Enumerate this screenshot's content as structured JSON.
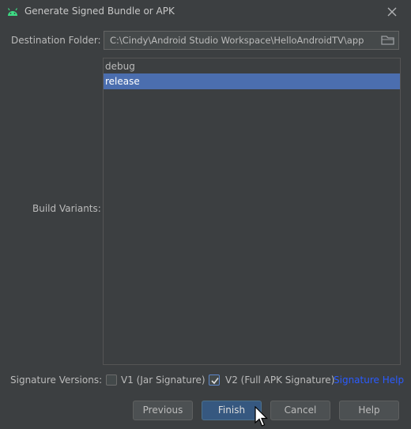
{
  "window": {
    "title": "Generate Signed Bundle or APK",
    "app_icon": "android-icon",
    "close_icon": "close-icon"
  },
  "destination": {
    "label": "Destination Folder:",
    "value": "C:\\Cindy\\Android Studio Workspace\\HelloAndroidTV\\app",
    "browse_icon": "folder-icon"
  },
  "build_variants": {
    "label": "Build Variants:",
    "items": [
      {
        "label": "debug",
        "selected": false
      },
      {
        "label": "release",
        "selected": true
      }
    ]
  },
  "signature": {
    "label": "Signature Versions:",
    "v1": {
      "label": "V1 (Jar Signature)",
      "checked": false
    },
    "v2": {
      "label": "V2 (Full APK Signature)",
      "checked": true
    },
    "help_link": "Signature Help"
  },
  "buttons": {
    "previous": "Previous",
    "finish": "Finish",
    "cancel": "Cancel",
    "help": "Help"
  },
  "colors": {
    "background": "#3c3f41",
    "selection": "#4b6eaf",
    "primary_button": "#365880",
    "link": "#2a5bff",
    "android_green": "#3ddc84"
  }
}
